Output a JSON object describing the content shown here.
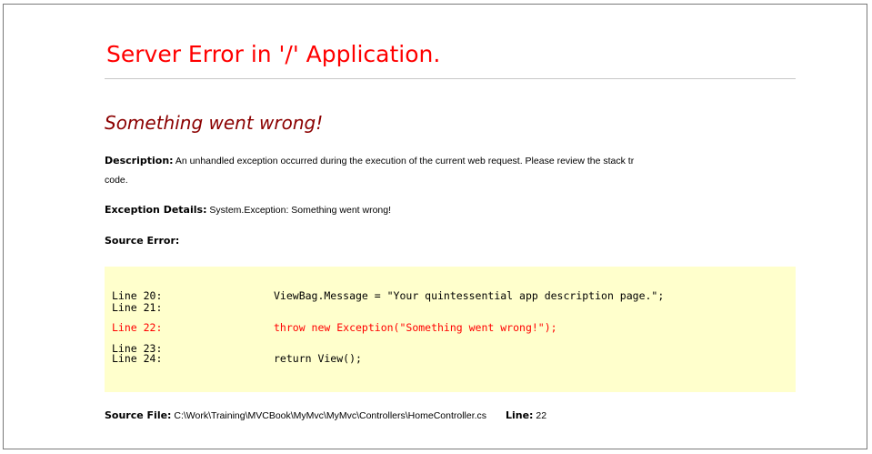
{
  "page": {
    "title": "Server Error in '/' Application.",
    "subtitle": "Something went wrong!"
  },
  "description": {
    "label": "Description:",
    "text_line1": "An unhandled exception occurred during the execution of the current web request. Please review the stack tr",
    "text_line2": "code."
  },
  "exception": {
    "label": "Exception Details:",
    "text": "System.Exception: Something went wrong!"
  },
  "source_error": {
    "label": "Source Error:",
    "lines": [
      {
        "number": "Line 20:",
        "code": "ViewBag.Message = \"Your quintessential app description page.\";"
      },
      {
        "number": "Line 21:",
        "code": ""
      },
      {
        "number": "Line 22:",
        "code": "throw new Exception(\"Something went wrong!\");"
      },
      {
        "number": "Line 23:",
        "code": ""
      },
      {
        "number": "Line 24:",
        "code": "return View();"
      }
    ]
  },
  "source_file": {
    "label": "Source File:",
    "path": "C:\\Work\\Training\\MVCBook\\MyMvc\\MyMvc\\Controllers\\HomeController.cs",
    "line_label": "Line:",
    "line_number": "22"
  },
  "colors": {
    "title": "#ff0000",
    "subtitle": "#8b0000",
    "code_background": "#ffffcc",
    "error_line": "#ff0000"
  }
}
